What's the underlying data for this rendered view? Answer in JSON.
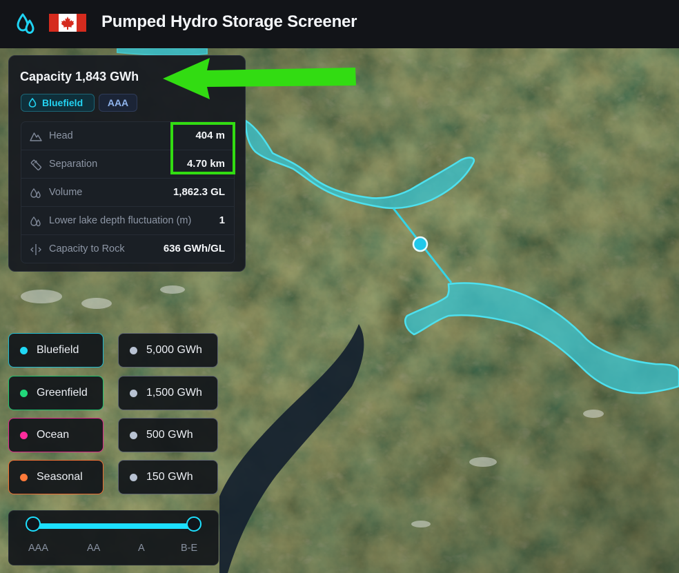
{
  "app": {
    "title": "Pumped Hydro Storage Screener"
  },
  "flag": {
    "colors": {
      "red": "#d52b1e",
      "white": "#ffffff"
    }
  },
  "info_panel": {
    "capacity_title": "Capacity 1,843 GWh",
    "badges": {
      "type": "Bluefield",
      "class": "AAA"
    },
    "stats": [
      {
        "icon": "mountain-icon",
        "label": "Head",
        "value": "404 m"
      },
      {
        "icon": "ruler-icon",
        "label": "Separation",
        "value": "4.70 km"
      },
      {
        "icon": "droplets-icon",
        "label": "Volume",
        "value": "1,862.3 GL"
      },
      {
        "icon": "droplets-icon",
        "label": "Lower lake depth fluctuation (m)",
        "value": "1"
      },
      {
        "icon": "split-icon",
        "label": "Capacity to Rock",
        "value": "636 GWh/GL"
      }
    ]
  },
  "legend": {
    "types": [
      {
        "label": "Bluefield",
        "color": "#20d8f5",
        "border": "#1fb8cf"
      },
      {
        "label": "Greenfield",
        "color": "#21d87a",
        "border": "#1ec06f"
      },
      {
        "label": "Ocean",
        "color": "#ff2c9c",
        "border": "#e0288c"
      },
      {
        "label": "Seasonal",
        "color": "#ff7a3a",
        "border": "#ee6f33"
      }
    ],
    "sizes": [
      {
        "label": "5,000 GWh"
      },
      {
        "label": "1,500 GWh"
      },
      {
        "label": "500 GWh"
      },
      {
        "label": "150 GWh"
      }
    ],
    "size_dot_color": "#b8c2d2"
  },
  "class_slider": {
    "labels": [
      "AAA",
      "AA",
      "A",
      "B-E"
    ],
    "selected_range": [
      "AAA",
      "B-E"
    ],
    "accent": "#1de0ff"
  },
  "colors": {
    "reservoir": "#35c6d6",
    "annotation": "#32dc12"
  }
}
